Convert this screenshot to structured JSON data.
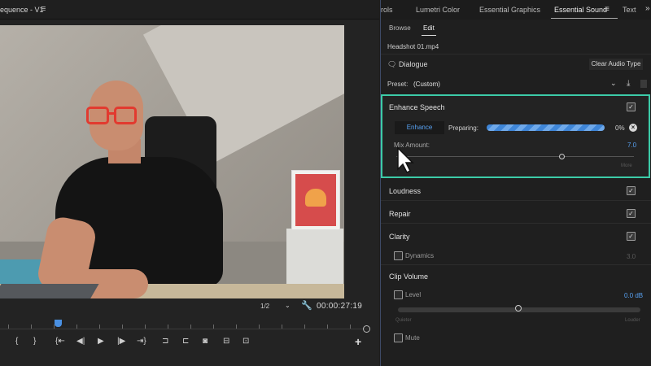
{
  "monitor": {
    "sequence_tab": "equence - V1",
    "menu_icon": "≡",
    "fit": "1/2",
    "fit_chevron": "⌄",
    "wrench_icon": "🔧",
    "timecode": "00:00:27:19",
    "transport": {
      "mark_in": "{",
      "mark_out": "}",
      "go_to_in": "{⇤",
      "step_back": "◀|",
      "play": "▶",
      "step_forward": "|▶",
      "go_to_out": "⇥}",
      "insert": "⊐",
      "overwrite": "⊏",
      "export_frame": "◙",
      "compare": "⊟",
      "lift": "⊡",
      "add": "+"
    }
  },
  "panel": {
    "tabs": [
      "rols",
      "Lumetri Color",
      "Essential Graphics",
      "Essential Sound",
      "Text"
    ],
    "active_tab": "Essential Sound",
    "tab_menu_icon": "≡",
    "more_icon": "»",
    "subtabs": [
      "Browse",
      "Edit"
    ],
    "active_subtab": "Edit",
    "clip_name": "Headshot 01.mp4",
    "clip_type": "Dialogue",
    "dialogue_icon": "🗨",
    "clear_button": "Clear Audio Type",
    "preset_label": "Preset:",
    "preset_value": "(Custom)",
    "preset_chevron": "⌄",
    "save_preset_icon": "⤓",
    "enhance": {
      "title": "Enhance Speech",
      "checked": true,
      "check": "✓",
      "button": "Enhance",
      "status_label": "Preparing:",
      "progress": 0,
      "progress_text": "0%",
      "cancel_icon": "×",
      "mix_label": "Mix Amount:",
      "mix_value": "7.0",
      "mix_fraction": 0.7,
      "mix_right": "More"
    },
    "sections": [
      {
        "title": "Loudness",
        "checked": true
      },
      {
        "title": "Repair",
        "checked": true
      },
      {
        "title": "Clarity",
        "checked": true
      }
    ],
    "dynamics_label": "Dynamics",
    "dynamics_value": "3.0",
    "clip_volume": {
      "title": "Clip Volume",
      "level_label": "Level",
      "level_value": "0.0 dB",
      "level_fraction": 0.5,
      "min_label": "Quieter",
      "max_label": "Louder",
      "mute_label": "Mute"
    },
    "accent_color": "#3ccba8",
    "blue_color": "#57a0f0"
  }
}
